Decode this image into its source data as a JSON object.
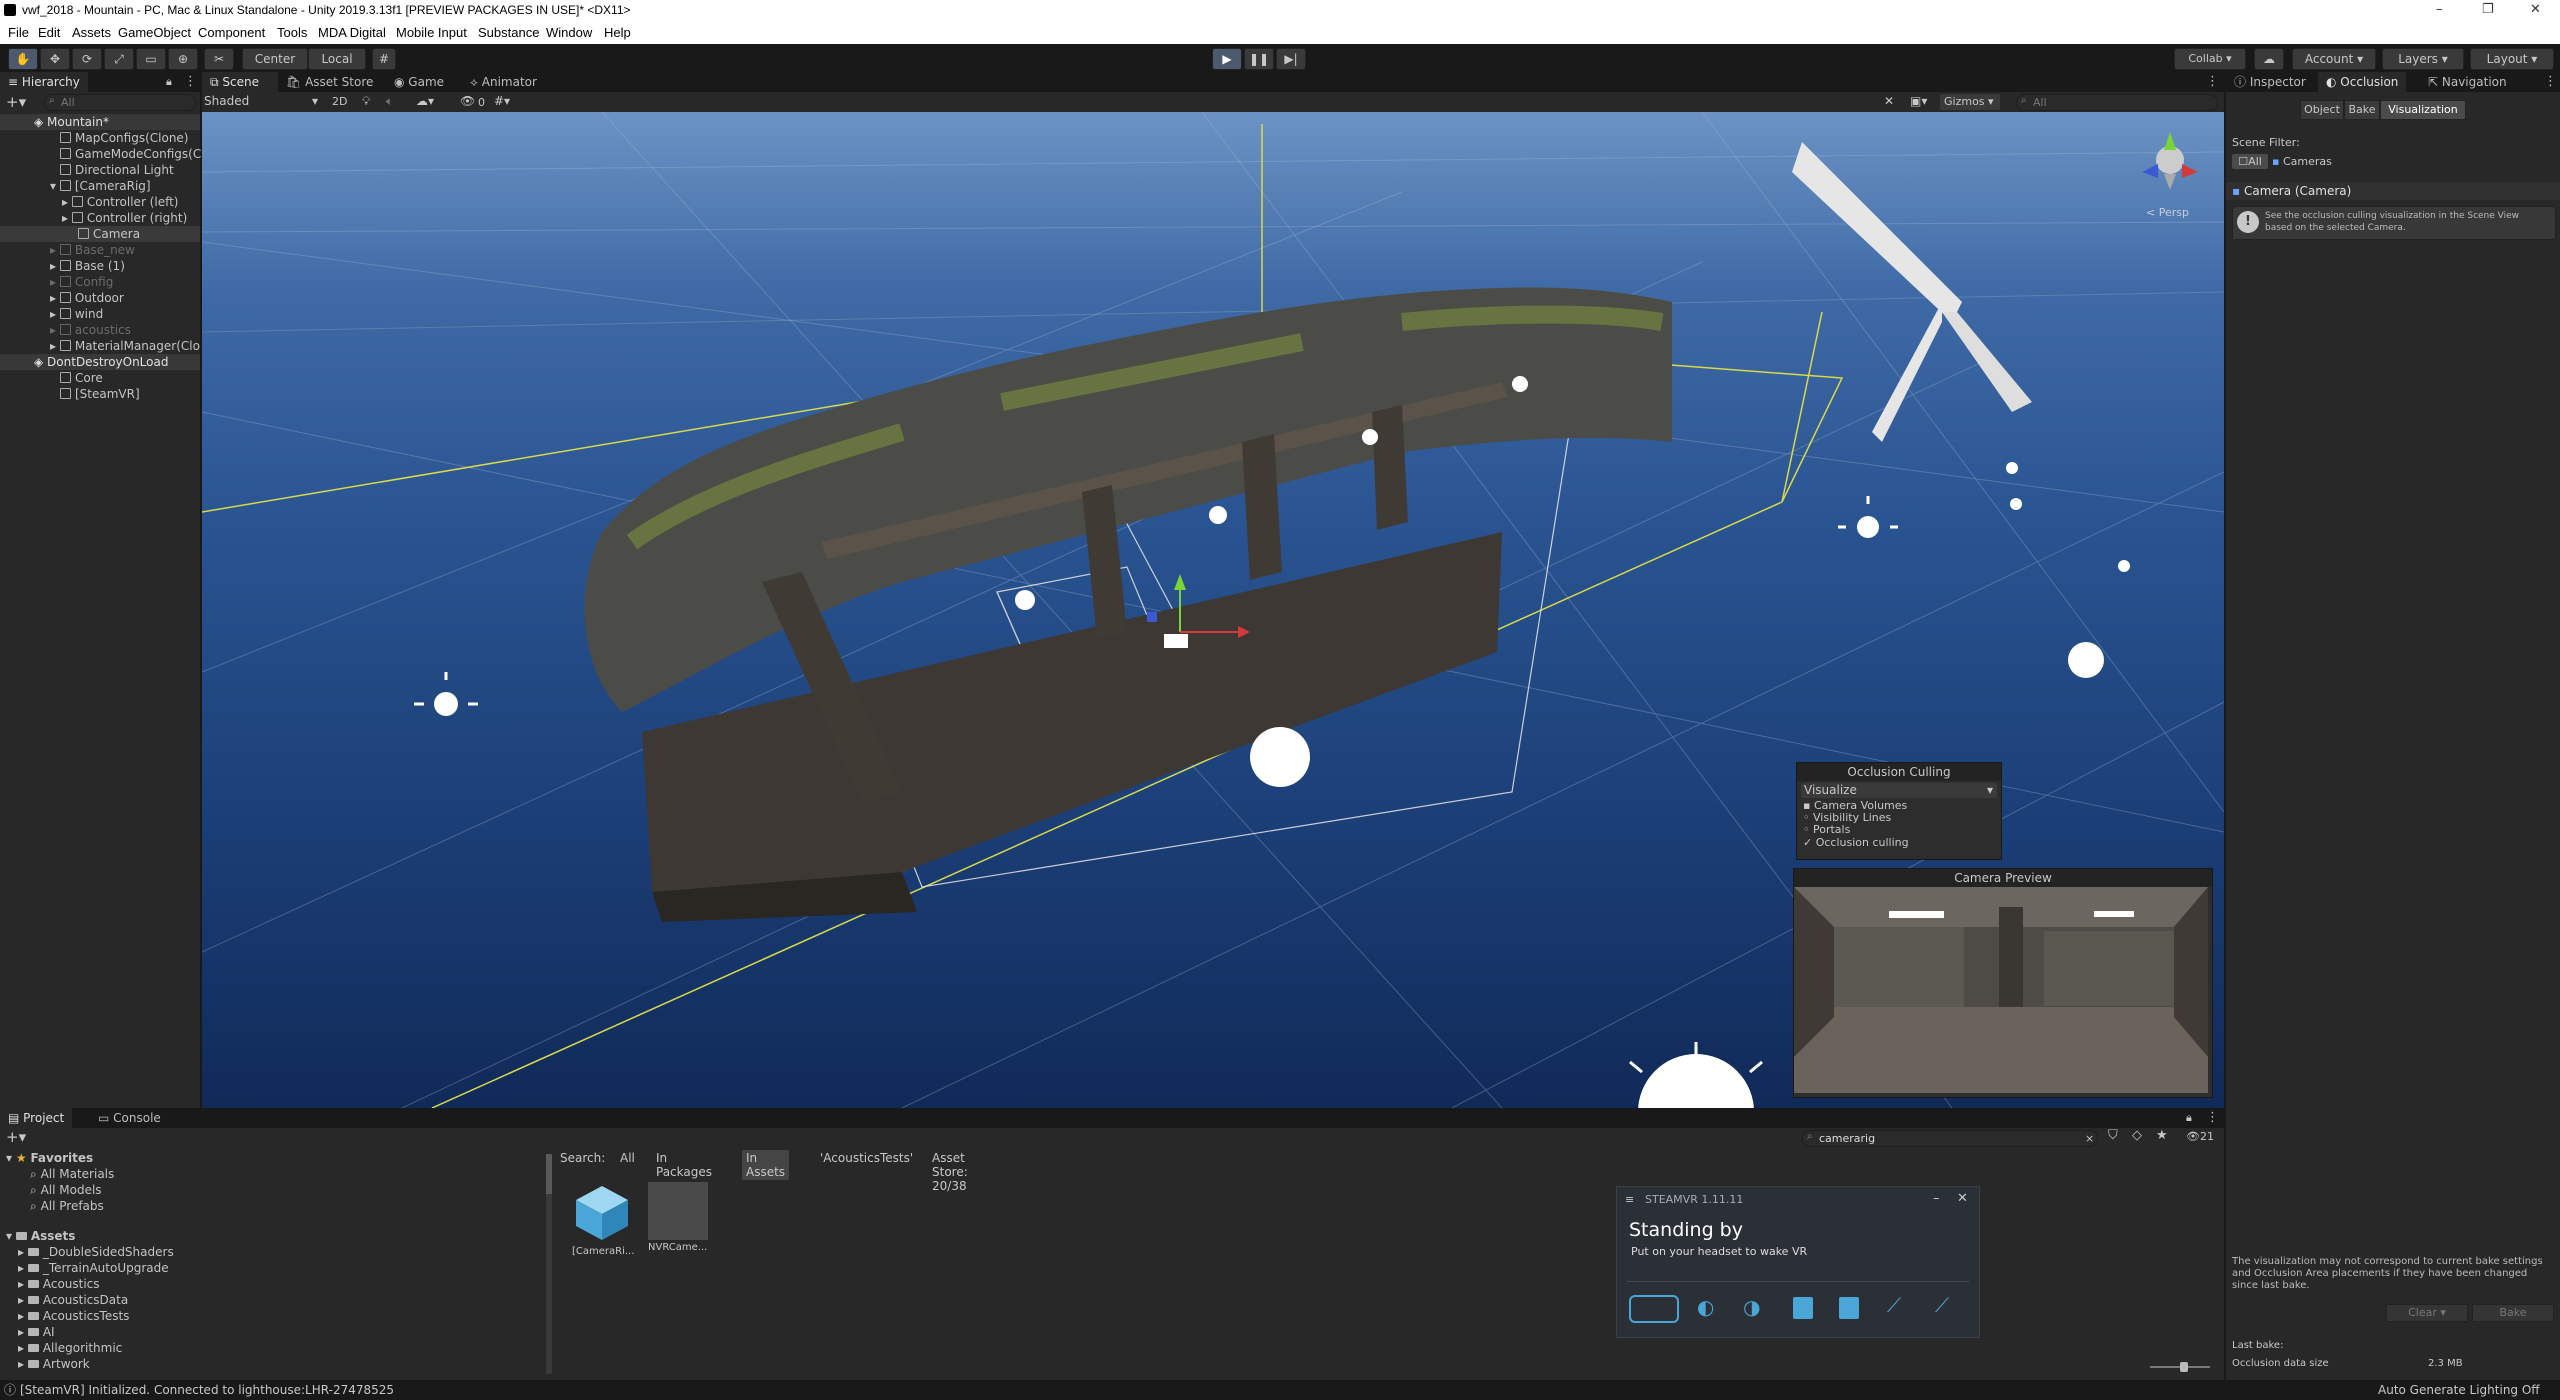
{
  "window": {
    "title": "vwf_2018 - Mountain - PC, Mac & Linux Standalone - Unity 2019.3.13f1 [PREVIEW PACKAGES IN USE]* <DX11>",
    "minimize": "–",
    "maximize": "❐",
    "close": "✕"
  },
  "menu": [
    "File",
    "Edit",
    "Assets",
    "GameObject",
    "Component",
    "Tools",
    "MDA Digital",
    "Mobile Input",
    "Substance",
    "Window",
    "Help"
  ],
  "toolbar": {
    "pivot": "Center",
    "space": "Local",
    "collab": "Collab",
    "account": "Account",
    "layers": "Layers",
    "layout": "Layout"
  },
  "hierarchy": {
    "tab": "Hierarchy",
    "search_placeholder": "All",
    "rows": [
      {
        "label": "Mountain*",
        "kind": "scene"
      },
      {
        "label": "MapConfigs(Clone)",
        "kind": "normal"
      },
      {
        "label": "GameModeConfigs(C",
        "kind": "normal"
      },
      {
        "label": "Directional Light",
        "kind": "normal"
      },
      {
        "label": "[CameraRig]",
        "kind": "normal"
      },
      {
        "label": "Controller (left)",
        "kind": "normal"
      },
      {
        "label": "Controller (right)",
        "kind": "normal"
      },
      {
        "label": "Camera",
        "kind": "selected"
      },
      {
        "label": "Base_new",
        "kind": "dim"
      },
      {
        "label": "Base (1)",
        "kind": "normal"
      },
      {
        "label": "Config",
        "kind": "dim"
      },
      {
        "label": "Outdoor",
        "kind": "normal"
      },
      {
        "label": "wind",
        "kind": "normal"
      },
      {
        "label": "acoustics",
        "kind": "dim"
      },
      {
        "label": "MaterialManager(Clo",
        "kind": "normal"
      },
      {
        "label": "DontDestroyOnLoad",
        "kind": "scene"
      },
      {
        "label": "Core",
        "kind": "normal"
      },
      {
        "label": "[SteamVR]",
        "kind": "normal"
      }
    ]
  },
  "scene": {
    "tabs": [
      "Scene",
      "Asset Store",
      "Game",
      "Animator"
    ],
    "shading": "Shaded",
    "mode_2d": "2D",
    "fx_count": "0",
    "gizmos": "Gizmos",
    "search_placeholder": "All",
    "persp_label": "< Persp",
    "occlusion_panel": {
      "title": "Occlusion Culling",
      "mode": "Visualize",
      "options": [
        "Camera Volumes",
        "Visibility Lines",
        "Portals",
        "Occlusion culling"
      ]
    },
    "camera_preview_title": "Camera Preview"
  },
  "inspector": {
    "tabs": [
      "Inspector",
      "Occlusion",
      "Navigation"
    ],
    "modes": [
      "Object",
      "Bake",
      "Visualization"
    ],
    "scene_filter_label": "Scene Filter:",
    "filter_all": "All",
    "filter_cameras": "Cameras",
    "camera_header": "Camera (Camera)",
    "info": "See the occlusion culling visualization in the Scene View based on the selected Camera.",
    "warning": "The visualization may not correspond to current bake settings and Occlusion Area placements if they have been changed since last bake.",
    "clear_button": "Clear",
    "bake_button": "Bake",
    "last_bake_label": "Last bake:",
    "occlusion_size_label": "Occlusion data size",
    "occlusion_size_value": "2.3 MB"
  },
  "project": {
    "tabs": [
      "Project",
      "Console"
    ],
    "search_value": "camerarig",
    "result_count": "21",
    "search_label": "Search:",
    "search_scopes": [
      "All",
      "In Packages",
      "In Assets",
      "'AcousticsTests'",
      "Asset Store: 20/38"
    ],
    "favorites_label": "Favorites",
    "favorites": [
      "All Materials",
      "All Models",
      "All Prefabs"
    ],
    "assets_label": "Assets",
    "folders": [
      "_DoubleSidedShaders",
      "_TerrainAutoUpgrade",
      "Acoustics",
      "AcousticsData",
      "AcousticsTests",
      "AI",
      "Allegorithmic",
      "Artwork"
    ],
    "results": [
      "[CameraRi...",
      "NVRCame..."
    ]
  },
  "steamvr": {
    "title": "STEAMVR 1.11.11",
    "heading": "Standing by",
    "subtitle": "Put on your headset to wake VR"
  },
  "status": {
    "message": "[SteamVR] Initialized. Connected to lighthouse:LHR-27478525",
    "right": "Auto Generate Lighting Off"
  }
}
